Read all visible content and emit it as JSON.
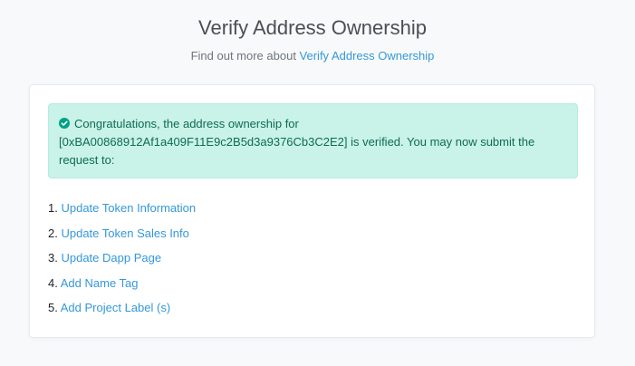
{
  "header": {
    "title": "Verify Address Ownership",
    "subtitle_prefix": "Find out more about ",
    "subtitle_link": "Verify Address Ownership"
  },
  "alert": {
    "icon": "check-circle-icon",
    "color": "#0e6b55",
    "background": "#c9f2e8",
    "text_before": "Congratulations, the address ownership for ",
    "address": "[0xBA00868912Af1a409F11E9c2B5d3a9376Cb3C2E2]",
    "text_after": " is verified. You may now submit the request to:"
  },
  "steps": [
    {
      "num": "1.",
      "label": "Update Token Information"
    },
    {
      "num": "2.",
      "label": "Update Token Sales Info"
    },
    {
      "num": "3.",
      "label": "Update Dapp Page"
    },
    {
      "num": "4.",
      "label": "Add Name Tag"
    },
    {
      "num": "5.",
      "label": "Add Project Label (s)"
    }
  ],
  "colors": {
    "link": "#3498db",
    "page_bg": "#f8f9fa"
  }
}
